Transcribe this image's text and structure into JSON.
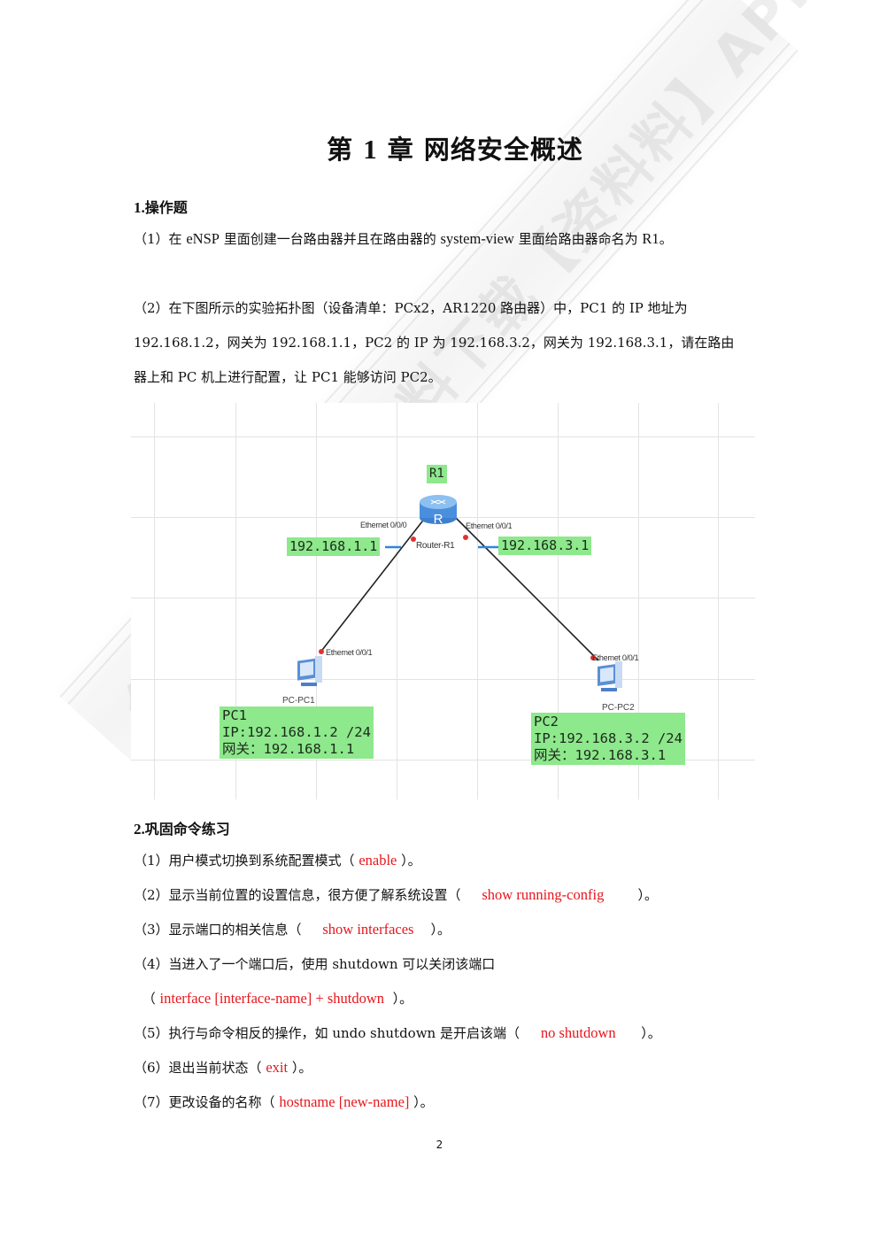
{
  "chapter": {
    "prefix": "第",
    "number": "1",
    "suffix": "章",
    "title": "网络安全概述"
  },
  "section1": {
    "index": "1.",
    "heading": "操作题",
    "q1": {
      "label": "（1）",
      "text_a": "在 ",
      "latin_a": "eNSP",
      "text_b": " 里面创建一台路由器并且在路由器的 ",
      "latin_b": "system-view",
      "text_c": " 里面给路由器命名为 ",
      "latin_c": "R1",
      "text_d": "。"
    },
    "q2": {
      "line1": "（2）在下图所示的实验拓扑图（设备清单：PCx2，AR1220 路由器）中，PC1  的 IP 地址为",
      "line2": "192.168.1.2，网关为 192.168.1.1，PC2  的 IP 为 192.168.3.2，网关为 192.168.3.1，请在路由",
      "line3": "器上和 PC 机上进行配置，让 PC1 能够访问 PC2。"
    }
  },
  "topology": {
    "router": {
      "tag": "R1",
      "name": "Router-R1",
      "port_left": "Ethernet 0/0/0",
      "port_right": "Ethernet 0/0/1",
      "ip_left": "192.168.1.1",
      "ip_right": "192.168.3.1"
    },
    "pc1": {
      "name": "PC-PC1",
      "port": "Ethernet 0/0/1",
      "info": [
        "PC1",
        "IP:192.168.1.2 /24",
        "网关：192.168.1.1"
      ]
    },
    "pc2": {
      "name": "PC-PC2",
      "port": "Ethernet 0/0/1",
      "info": [
        "PC2",
        "IP:192.168.3.2 /24",
        "网关：192.168.3.1"
      ]
    },
    "colors": {
      "label_green": "#8ee88c",
      "link": "#222222",
      "port_dot": "#e53030",
      "ip_dash": "#2e86de"
    }
  },
  "section2": {
    "index": "2.",
    "heading": "巩固命令练习",
    "items": [
      {
        "prefix": "（1）用户模式切换到系统配置模式（ ",
        "answer": "enable",
        "suffix": " ）。"
      },
      {
        "prefix": "（2）显示当前位置的设置信息，很方便了解系统设置（     ",
        "answer": "show running-config",
        "suffix": "        ）。"
      },
      {
        "prefix": "（3）显示端口的相关信息（     ",
        "answer": "show interfaces",
        "suffix": "    ）。"
      },
      {
        "prefix": "（4）当进入了一个端口后，使用 shutdown 可以关闭该端口",
        "answer": "",
        "suffix": ""
      },
      {
        "prefix": " （ ",
        "answer": "interface [interface-name] + shutdown",
        "suffix": "  ）。"
      },
      {
        "prefix": "（5）执行与命令相反的操作，如 undo shutdown 是开启该端（     ",
        "answer": "no shutdown",
        "suffix": "      ）。"
      },
      {
        "prefix": "（6）退出当前状态（ ",
        "answer": "exit",
        "suffix": " ）。"
      },
      {
        "prefix": "（7）更改设备的名称（ ",
        "answer": "hostname [new-name]",
        "suffix": " ）。"
      }
    ],
    "answer_color": "#e8161c"
  },
  "footer": {
    "page_number": "2"
  },
  "watermark": {
    "text": "免费查看学习资料下载【资料料】APP"
  }
}
